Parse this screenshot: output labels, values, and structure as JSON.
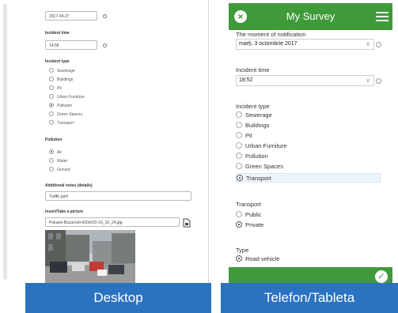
{
  "desktop": {
    "date_value": "2017-09-27",
    "incident_time_label": "Incident time",
    "time_value": "14:58",
    "incident_type_label": "Incident type",
    "incident_types": [
      {
        "label": "Sewerage",
        "selected": false
      },
      {
        "label": "Buildings",
        "selected": false
      },
      {
        "label": "Pit",
        "selected": false
      },
      {
        "label": "Urban Furniture",
        "selected": false
      },
      {
        "label": "Pollution",
        "selected": true
      },
      {
        "label": "Green Spaces",
        "selected": false
      },
      {
        "label": "Transport",
        "selected": false
      }
    ],
    "pollution_label": "Pollution",
    "pollution_options": [
      {
        "label": "Air",
        "selected": true
      },
      {
        "label": "Water",
        "selected": false
      },
      {
        "label": "Ground",
        "selected": false
      }
    ],
    "notes_label": "Additional notes (details)",
    "notes_value": "Traffic jam!",
    "picture_label": "Insert/Take a picture",
    "picture_value": "Poluare-Bucuresti-920x510-16_10_24.jpg",
    "attach_icon": "file-icon"
  },
  "phone": {
    "app_title": "My Survey",
    "close_icon": "close-icon",
    "menu_icon": "hamburger-menu-icon",
    "notification_label": "The moment of notification",
    "notification_value": "marți, 3 octombrie 2017",
    "incident_time_label": "Incident time",
    "incident_time_value": "18:52",
    "incident_type_label": "Incident type",
    "incident_types": [
      {
        "label": "Sewerage",
        "selected": false
      },
      {
        "label": "Buildings",
        "selected": false
      },
      {
        "label": "Pit",
        "selected": false
      },
      {
        "label": "Urban Furniture",
        "selected": false
      },
      {
        "label": "Pollution",
        "selected": false
      },
      {
        "label": "Green Spaces",
        "selected": false
      },
      {
        "label": "Transport",
        "selected": true
      }
    ],
    "transport_label": "Transport",
    "transport_options": [
      {
        "label": "Public",
        "selected": false
      },
      {
        "label": "Private",
        "selected": true
      }
    ],
    "type_label": "Type",
    "type_options": [
      {
        "label": "Road vehicle",
        "selected": true
      }
    ],
    "submit_icon": "check-icon"
  },
  "labels": {
    "desktop_banner": "Desktop",
    "phone_banner": "Telefon/Tableta"
  },
  "colors": {
    "accent_green": "#3f9a3a",
    "banner_blue": "#2b72c0"
  }
}
